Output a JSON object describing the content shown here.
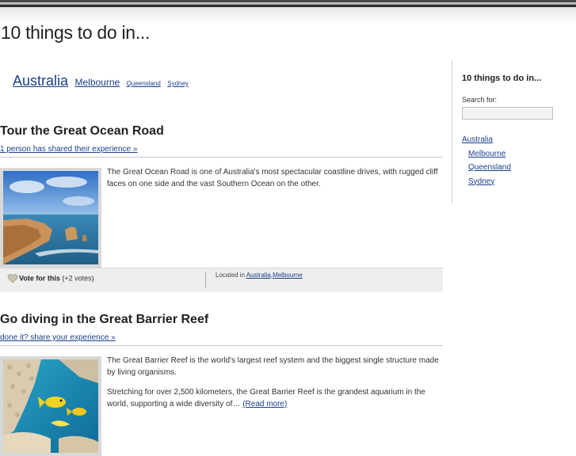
{
  "site": {
    "title": "10 things to do in..."
  },
  "location_nav": [
    "Australia",
    "Melbourne",
    "Queensland",
    "Sydney"
  ],
  "posts": [
    {
      "title": "Tour the Great Ocean Road",
      "share_link": "1 person has shared their experience »",
      "paragraphs": [
        "The Great Ocean Road is one of Australia's most spectacular coastline drives, with rugged cliff faces on one side and the vast Southern Ocean on the other."
      ],
      "vote_label": "Vote for this",
      "vote_count": "(+2 votes)",
      "located_prefix": "Located in",
      "locations": [
        "Australia",
        "Melbourne"
      ]
    },
    {
      "title": "Go diving in the Great Barrier Reef",
      "share_link": "done it? share your experience »",
      "paragraphs": [
        "The Great Barrier Reef is the world's largest reef system and the biggest single structure made by living organisms.",
        "Stretching for over 2,500 kilometers, the Great Barrier Reef is the grandest aquarium in the world, supporting a wide diversity of…"
      ],
      "read_more": "(Read more)"
    }
  ],
  "sidebar": {
    "title": "10 things to do in...",
    "search_label": "Search for:",
    "search_value": "",
    "links": [
      "Australia",
      "Melbourne",
      "Queensland",
      "Sydney"
    ]
  }
}
